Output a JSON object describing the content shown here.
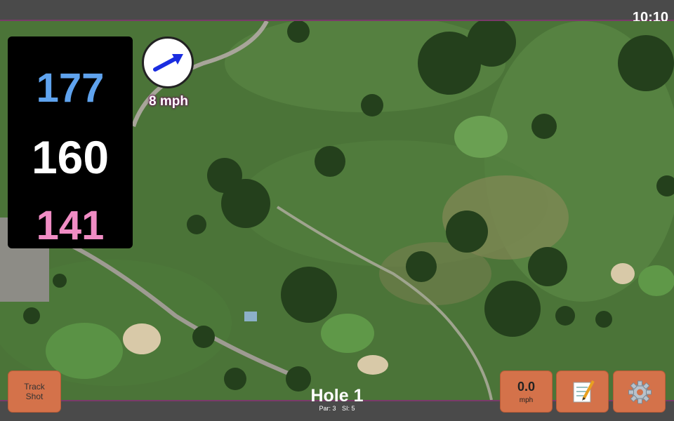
{
  "status_bar": {
    "time": "10:10"
  },
  "distances": {
    "back": "177",
    "middle": "160",
    "front": "141"
  },
  "wind": {
    "speed_label": "8 mph",
    "icon": "arrow-icon",
    "direction": "east-northeast"
  },
  "hole": {
    "title": "Hole 1",
    "par": "Par: 3",
    "stroke_index": "SI: 5"
  },
  "buttons": {
    "track_shot": "Track Shot",
    "speed_value": "0.0",
    "speed_unit": "mph",
    "notes_icon": "notepad-icon",
    "settings_icon": "gear-icon"
  },
  "colors": {
    "back": "#5fa3ee",
    "middle": "#ffffff",
    "front": "#f08cc4",
    "button": "#d4724a",
    "accent_border": "#7a3a6a"
  }
}
